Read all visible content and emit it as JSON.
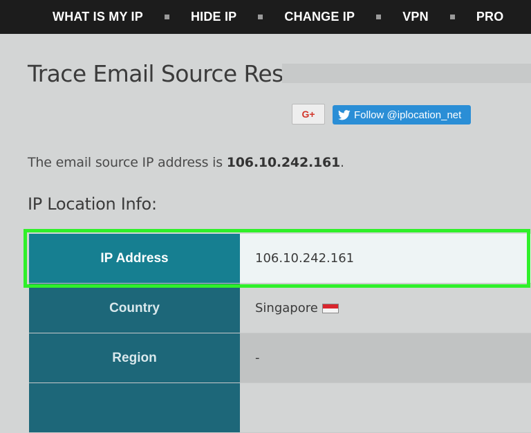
{
  "nav": {
    "items": [
      "WHAT IS MY IP",
      "HIDE IP",
      "CHANGE IP",
      "VPN",
      "PRO"
    ]
  },
  "page": {
    "title": "Trace Email Source Result",
    "source_prefix": "The email source IP address is ",
    "source_ip": "106.10.242.161",
    "source_suffix": ".",
    "section_title": "IP Location Info:"
  },
  "share": {
    "gplus_label": "G+",
    "twitter_label": "Follow @iplocation_net"
  },
  "table": {
    "rows": [
      {
        "label": "IP Address",
        "value": "106.10.242.161"
      },
      {
        "label": "Country",
        "value": "Singapore"
      },
      {
        "label": "Region",
        "value": "-"
      },
      {
        "label": "",
        "value": ""
      }
    ]
  },
  "colors": {
    "nav_bg": "#1c1c1c",
    "label_bg": "#1d6779",
    "highlight": "#2ff02a",
    "twitter": "#2a8ed6"
  },
  "icons": {
    "country_flag": "singapore-flag-icon",
    "twitter": "twitter-bird-icon"
  }
}
